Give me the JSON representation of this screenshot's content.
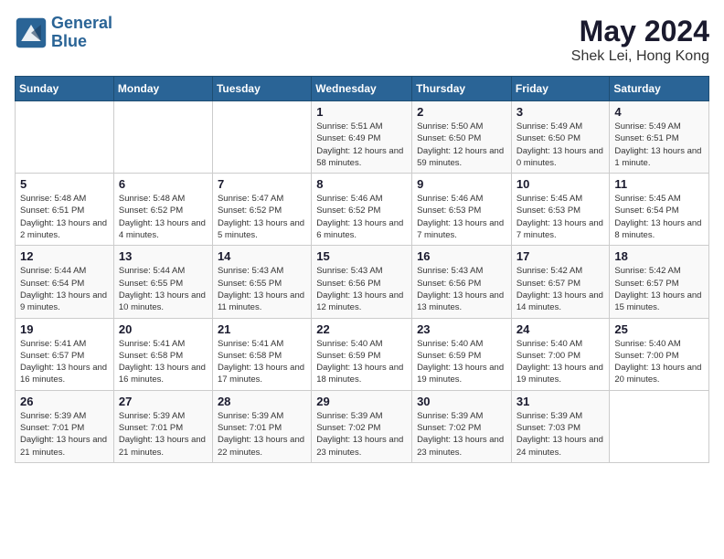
{
  "header": {
    "logo_line1": "General",
    "logo_line2": "Blue",
    "month_year": "May 2024",
    "location": "Shek Lei, Hong Kong"
  },
  "weekdays": [
    "Sunday",
    "Monday",
    "Tuesday",
    "Wednesday",
    "Thursday",
    "Friday",
    "Saturday"
  ],
  "weeks": [
    [
      {
        "day": "",
        "info": ""
      },
      {
        "day": "",
        "info": ""
      },
      {
        "day": "",
        "info": ""
      },
      {
        "day": "1",
        "info": "Sunrise: 5:51 AM\nSunset: 6:49 PM\nDaylight: 12 hours and 58 minutes."
      },
      {
        "day": "2",
        "info": "Sunrise: 5:50 AM\nSunset: 6:50 PM\nDaylight: 12 hours and 59 minutes."
      },
      {
        "day": "3",
        "info": "Sunrise: 5:49 AM\nSunset: 6:50 PM\nDaylight: 13 hours and 0 minutes."
      },
      {
        "day": "4",
        "info": "Sunrise: 5:49 AM\nSunset: 6:51 PM\nDaylight: 13 hours and 1 minute."
      }
    ],
    [
      {
        "day": "5",
        "info": "Sunrise: 5:48 AM\nSunset: 6:51 PM\nDaylight: 13 hours and 2 minutes."
      },
      {
        "day": "6",
        "info": "Sunrise: 5:48 AM\nSunset: 6:52 PM\nDaylight: 13 hours and 4 minutes."
      },
      {
        "day": "7",
        "info": "Sunrise: 5:47 AM\nSunset: 6:52 PM\nDaylight: 13 hours and 5 minutes."
      },
      {
        "day": "8",
        "info": "Sunrise: 5:46 AM\nSunset: 6:52 PM\nDaylight: 13 hours and 6 minutes."
      },
      {
        "day": "9",
        "info": "Sunrise: 5:46 AM\nSunset: 6:53 PM\nDaylight: 13 hours and 7 minutes."
      },
      {
        "day": "10",
        "info": "Sunrise: 5:45 AM\nSunset: 6:53 PM\nDaylight: 13 hours and 7 minutes."
      },
      {
        "day": "11",
        "info": "Sunrise: 5:45 AM\nSunset: 6:54 PM\nDaylight: 13 hours and 8 minutes."
      }
    ],
    [
      {
        "day": "12",
        "info": "Sunrise: 5:44 AM\nSunset: 6:54 PM\nDaylight: 13 hours and 9 minutes."
      },
      {
        "day": "13",
        "info": "Sunrise: 5:44 AM\nSunset: 6:55 PM\nDaylight: 13 hours and 10 minutes."
      },
      {
        "day": "14",
        "info": "Sunrise: 5:43 AM\nSunset: 6:55 PM\nDaylight: 13 hours and 11 minutes."
      },
      {
        "day": "15",
        "info": "Sunrise: 5:43 AM\nSunset: 6:56 PM\nDaylight: 13 hours and 12 minutes."
      },
      {
        "day": "16",
        "info": "Sunrise: 5:43 AM\nSunset: 6:56 PM\nDaylight: 13 hours and 13 minutes."
      },
      {
        "day": "17",
        "info": "Sunrise: 5:42 AM\nSunset: 6:57 PM\nDaylight: 13 hours and 14 minutes."
      },
      {
        "day": "18",
        "info": "Sunrise: 5:42 AM\nSunset: 6:57 PM\nDaylight: 13 hours and 15 minutes."
      }
    ],
    [
      {
        "day": "19",
        "info": "Sunrise: 5:41 AM\nSunset: 6:57 PM\nDaylight: 13 hours and 16 minutes."
      },
      {
        "day": "20",
        "info": "Sunrise: 5:41 AM\nSunset: 6:58 PM\nDaylight: 13 hours and 16 minutes."
      },
      {
        "day": "21",
        "info": "Sunrise: 5:41 AM\nSunset: 6:58 PM\nDaylight: 13 hours and 17 minutes."
      },
      {
        "day": "22",
        "info": "Sunrise: 5:40 AM\nSunset: 6:59 PM\nDaylight: 13 hours and 18 minutes."
      },
      {
        "day": "23",
        "info": "Sunrise: 5:40 AM\nSunset: 6:59 PM\nDaylight: 13 hours and 19 minutes."
      },
      {
        "day": "24",
        "info": "Sunrise: 5:40 AM\nSunset: 7:00 PM\nDaylight: 13 hours and 19 minutes."
      },
      {
        "day": "25",
        "info": "Sunrise: 5:40 AM\nSunset: 7:00 PM\nDaylight: 13 hours and 20 minutes."
      }
    ],
    [
      {
        "day": "26",
        "info": "Sunrise: 5:39 AM\nSunset: 7:01 PM\nDaylight: 13 hours and 21 minutes."
      },
      {
        "day": "27",
        "info": "Sunrise: 5:39 AM\nSunset: 7:01 PM\nDaylight: 13 hours and 21 minutes."
      },
      {
        "day": "28",
        "info": "Sunrise: 5:39 AM\nSunset: 7:01 PM\nDaylight: 13 hours and 22 minutes."
      },
      {
        "day": "29",
        "info": "Sunrise: 5:39 AM\nSunset: 7:02 PM\nDaylight: 13 hours and 23 minutes."
      },
      {
        "day": "30",
        "info": "Sunrise: 5:39 AM\nSunset: 7:02 PM\nDaylight: 13 hours and 23 minutes."
      },
      {
        "day": "31",
        "info": "Sunrise: 5:39 AM\nSunset: 7:03 PM\nDaylight: 13 hours and 24 minutes."
      },
      {
        "day": "",
        "info": ""
      }
    ]
  ]
}
